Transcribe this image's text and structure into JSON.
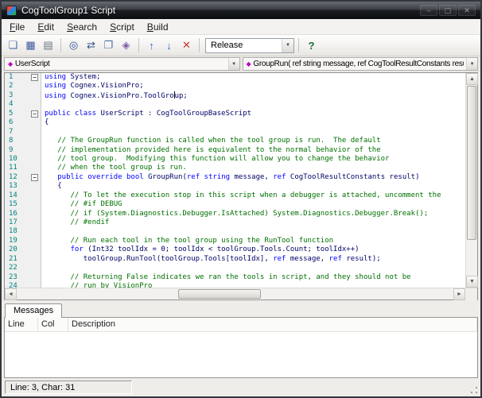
{
  "window": {
    "title": "CogToolGroup1 Script",
    "btn_min": "–",
    "btn_max": "▢",
    "btn_close": "✕"
  },
  "menu": {
    "items": [
      "File",
      "Edit",
      "Search",
      "Script",
      "Build"
    ]
  },
  "toolbar": {
    "icons": [
      {
        "name": "new-file-icon",
        "g": "❏",
        "c": "#4a6da7"
      },
      {
        "name": "save-icon",
        "g": "▦",
        "c": "#39579b"
      },
      {
        "name": "print-icon",
        "g": "▤",
        "c": "#6b7280"
      },
      {
        "sep": true
      },
      {
        "name": "find-icon",
        "g": "◎",
        "c": "#2f4f8f"
      },
      {
        "name": "replace-icon",
        "g": "⇄",
        "c": "#2f4f8f"
      },
      {
        "name": "copy-icon",
        "g": "❐",
        "c": "#4a6da7"
      },
      {
        "name": "bookmark-icon",
        "g": "◈",
        "c": "#7a5ea6"
      },
      {
        "sep": true
      },
      {
        "name": "navigate-up-icon",
        "g": "↑",
        "c": "#2b6cd4"
      },
      {
        "name": "navigate-down-icon",
        "g": "↓",
        "c": "#2b6cd4"
      },
      {
        "name": "delete-icon",
        "g": "✕",
        "c": "#c23a2f"
      },
      {
        "sep": true
      }
    ],
    "release_label": "Release",
    "combo_arrow": "▼",
    "help_glyph": "?"
  },
  "nav": {
    "icon_glyph": "◆",
    "left": "UserScript",
    "right": "GroupRun( ref string message,  ref CogToolResultConstants result)",
    "arrow": "▼"
  },
  "editor": {
    "scrollbar": {
      "up": "▲",
      "down": "▼",
      "left": "◄",
      "right": "►"
    },
    "fold_glyph": "−",
    "lines": [
      {
        "f": 1,
        "s": [
          [
            "k",
            "using"
          ],
          [
            "p",
            " System;"
          ]
        ]
      },
      {
        "s": [
          [
            "k",
            "using"
          ],
          [
            "p",
            " Cognex.VisionPro;"
          ]
        ]
      },
      {
        "s": [
          [
            "k",
            "using"
          ],
          [
            "p",
            " Cognex.VisionPro.ToolGro"
          ],
          [
            "r",
            ""
          ],
          [
            "p",
            "up;"
          ]
        ]
      },
      {
        "s": []
      },
      {
        "f": 1,
        "s": [
          [
            "k",
            "public"
          ],
          [
            "p",
            " "
          ],
          [
            "k",
            "class"
          ],
          [
            "p",
            " UserScript : CogToolGroupBaseScript"
          ]
        ]
      },
      {
        "s": [
          [
            "p",
            "{"
          ]
        ]
      },
      {
        "s": []
      },
      {
        "s": [
          [
            "c",
            "   // The GroupRun function is called when the tool group is run.  The default"
          ]
        ]
      },
      {
        "s": [
          [
            "c",
            "   // implementation provided here is equivalent to the normal behavior of the"
          ]
        ]
      },
      {
        "s": [
          [
            "c",
            "   // tool group.  Modifying this function will allow you to change the behavior"
          ]
        ]
      },
      {
        "s": [
          [
            "c",
            "   // when the tool group is run."
          ]
        ]
      },
      {
        "f": 1,
        "s": [
          [
            "p",
            "   "
          ],
          [
            "k",
            "public"
          ],
          [
            "p",
            " "
          ],
          [
            "k",
            "override"
          ],
          [
            "p",
            " "
          ],
          [
            "k",
            "bool"
          ],
          [
            "p",
            " GroupRun("
          ],
          [
            "k",
            "ref"
          ],
          [
            "p",
            " "
          ],
          [
            "k",
            "string"
          ],
          [
            "p",
            " message, "
          ],
          [
            "k",
            "ref"
          ],
          [
            "p",
            " CogToolResultConstants result)"
          ]
        ]
      },
      {
        "s": [
          [
            "p",
            "   {"
          ]
        ]
      },
      {
        "s": [
          [
            "c",
            "      // To let the execution stop in this script when a debugger is attached, uncomment the"
          ]
        ]
      },
      {
        "s": [
          [
            "c",
            "      // #if DEBUG"
          ]
        ]
      },
      {
        "s": [
          [
            "c",
            "      // if (System.Diagnostics.Debugger.IsAttached) System.Diagnostics.Debugger.Break();"
          ]
        ]
      },
      {
        "s": [
          [
            "c",
            "      // #endif"
          ]
        ]
      },
      {
        "s": []
      },
      {
        "s": [
          [
            "c",
            "      // Run each tool in the tool group using the RunTool function"
          ]
        ]
      },
      {
        "s": [
          [
            "p",
            "      "
          ],
          [
            "k",
            "for"
          ],
          [
            "p",
            " (Int32 toolIdx = 0; toolIdx < toolGroup.Tools.Count; toolIdx++)"
          ]
        ]
      },
      {
        "s": [
          [
            "p",
            "         toolGroup.RunTool(toolGroup.Tools[toolIdx], "
          ],
          [
            "k",
            "ref"
          ],
          [
            "p",
            " message, "
          ],
          [
            "k",
            "ref"
          ],
          [
            "p",
            " result);"
          ]
        ]
      },
      {
        "s": []
      },
      {
        "s": [
          [
            "c",
            "      // Returning False indicates we ran the tools in script, and they should not be"
          ]
        ]
      },
      {
        "s": [
          [
            "c",
            "      // run by VisionPro"
          ]
        ]
      }
    ]
  },
  "messages": {
    "tab": "Messages",
    "columns": [
      "Line",
      "Col",
      "Description"
    ]
  },
  "status": {
    "position": "Line: 3, Char: 31"
  }
}
